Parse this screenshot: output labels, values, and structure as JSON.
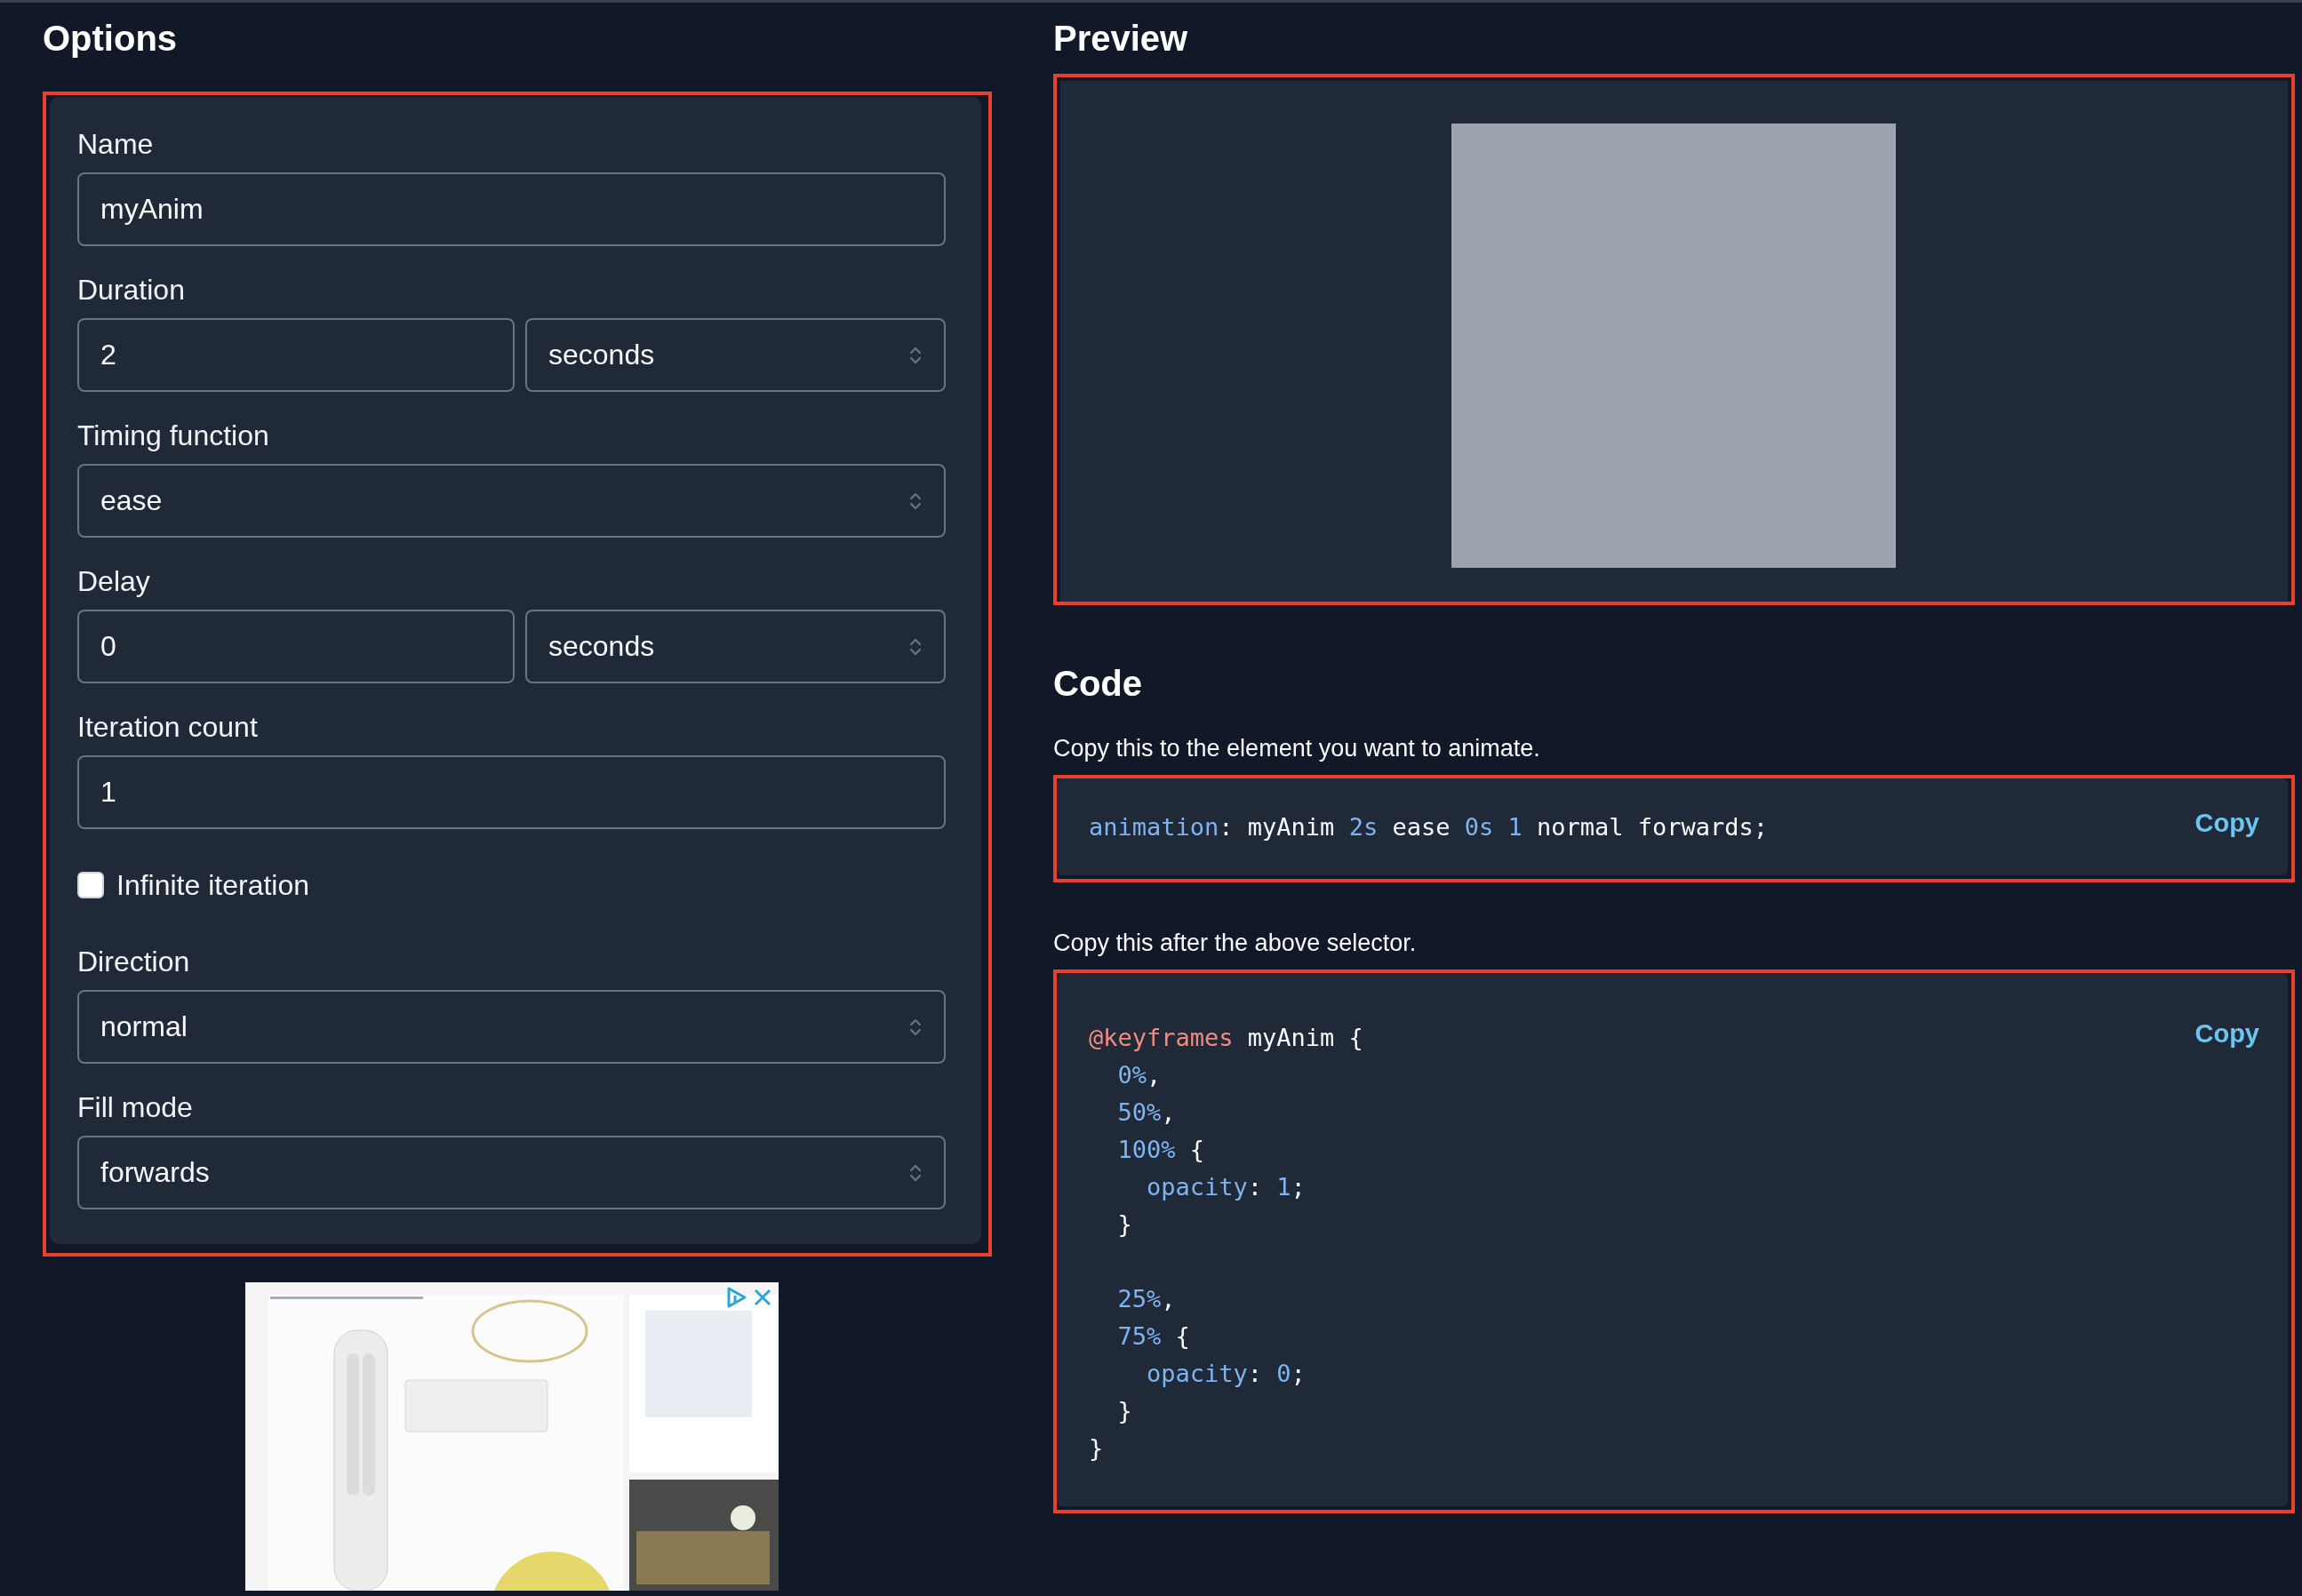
{
  "options": {
    "title": "Options",
    "fields": [
      {
        "kind": "text",
        "label": "Name",
        "value": "myAnim"
      },
      {
        "kind": "text-select",
        "label": "Duration",
        "value": "2",
        "unit": "seconds"
      },
      {
        "kind": "select",
        "label": "Timing function",
        "value": "ease"
      },
      {
        "kind": "text-select",
        "label": "Delay",
        "value": "0",
        "unit": "seconds"
      },
      {
        "kind": "text",
        "label": "Iteration count",
        "value": "1"
      },
      {
        "kind": "checkbox",
        "label": "Infinite iteration",
        "checked": false
      },
      {
        "kind": "select",
        "label": "Direction",
        "value": "normal"
      },
      {
        "kind": "select",
        "label": "Fill mode",
        "value": "forwards"
      }
    ]
  },
  "preview": {
    "title": "Preview"
  },
  "code": {
    "title": "Code",
    "blocks": [
      {
        "hint": "Copy this to the element you want to animate.",
        "copy": "Copy",
        "stanzas": [
          {
            "lines": [
              {
                "tokens": [
                  {
                    "kind": "prop",
                    "text": "animation"
                  },
                  {
                    "kind": "plain",
                    "text": ": myAnim "
                  },
                  {
                    "kind": "num",
                    "text": "2s"
                  },
                  {
                    "kind": "plain",
                    "text": " ease "
                  },
                  {
                    "kind": "num",
                    "text": "0s 1"
                  },
                  {
                    "kind": "plain",
                    "text": " normal forwards;"
                  }
                ]
              }
            ]
          }
        ]
      },
      {
        "hint": "Copy this after the above selector.",
        "copy": "Copy",
        "stanzas": [
          {
            "lines": [
              {
                "tokens": [
                  {
                    "kind": "at",
                    "text": "@keyframes"
                  },
                  {
                    "kind": "plain",
                    "text": " myAnim {"
                  }
                ]
              },
              {
                "tokens": [
                  {
                    "kind": "num",
                    "text": "  0%"
                  },
                  {
                    "kind": "plain",
                    "text": ","
                  }
                ]
              },
              {
                "tokens": [
                  {
                    "kind": "num",
                    "text": "  50%"
                  },
                  {
                    "kind": "plain",
                    "text": ","
                  }
                ]
              },
              {
                "tokens": [
                  {
                    "kind": "num",
                    "text": "  100%"
                  },
                  {
                    "kind": "plain",
                    "text": " {"
                  }
                ]
              },
              {
                "tokens": [
                  {
                    "kind": "prop",
                    "text": "    opacity"
                  },
                  {
                    "kind": "plain",
                    "text": ": "
                  },
                  {
                    "kind": "num",
                    "text": "1"
                  },
                  {
                    "kind": "plain",
                    "text": ";"
                  }
                ]
              },
              {
                "tokens": [
                  {
                    "kind": "plain",
                    "text": "  }"
                  }
                ]
              }
            ]
          },
          {
            "lines": [
              {
                "tokens": [
                  {
                    "kind": "num",
                    "text": "  25%"
                  },
                  {
                    "kind": "plain",
                    "text": ","
                  }
                ]
              },
              {
                "tokens": [
                  {
                    "kind": "num",
                    "text": "  75%"
                  },
                  {
                    "kind": "plain",
                    "text": " {"
                  }
                ]
              },
              {
                "tokens": [
                  {
                    "kind": "prop",
                    "text": "    opacity"
                  },
                  {
                    "kind": "plain",
                    "text": ": "
                  },
                  {
                    "kind": "num",
                    "text": "0"
                  },
                  {
                    "kind": "plain",
                    "text": ";"
                  }
                ]
              },
              {
                "tokens": [
                  {
                    "kind": "plain",
                    "text": "  }"
                  }
                ]
              },
              {
                "tokens": [
                  {
                    "kind": "plain",
                    "text": "}"
                  }
                ]
              }
            ]
          }
        ]
      }
    ]
  }
}
